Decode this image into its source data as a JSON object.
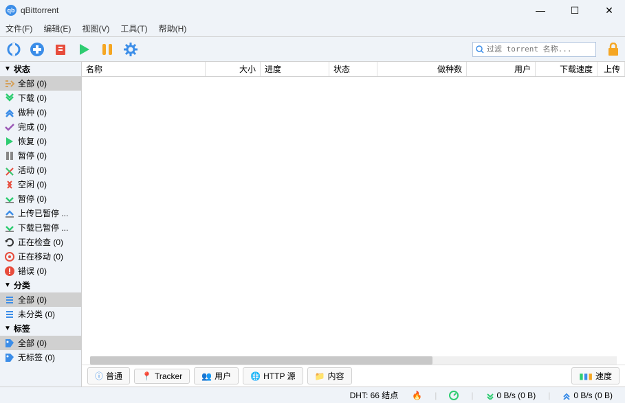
{
  "app": {
    "title": "qBittorrent"
  },
  "menu": {
    "file": "文件(F)",
    "edit": "编辑(E)",
    "view": "视图(V)",
    "tools": "工具(T)",
    "help": "帮助(H)"
  },
  "toolbar": {
    "search_placeholder": "过滤 torrent 名称..."
  },
  "sidebar": {
    "status_header": "状态",
    "status_items": [
      {
        "label": "全部 (0)",
        "color": "#d4a05a",
        "selected": true
      },
      {
        "label": "下载 (0)",
        "color": "#2ecc71"
      },
      {
        "label": "做种 (0)",
        "color": "#3b8de8"
      },
      {
        "label": "完成 (0)",
        "color": "#9b59b6"
      },
      {
        "label": "恢复 (0)",
        "color": "#2ecc71"
      },
      {
        "label": "暂停 (0)",
        "color": "#888888"
      },
      {
        "label": "活动 (0)",
        "color": "#e74c3c"
      },
      {
        "label": "空闲 (0)",
        "color": "#e74c3c"
      },
      {
        "label": "暂停 (0)",
        "color": "#2ecc71"
      },
      {
        "label": "上传已暂停 ...",
        "color": "#3b8de8"
      },
      {
        "label": "下载已暂停 ...",
        "color": "#2ecc71"
      },
      {
        "label": "正在检查 (0)",
        "color": "#333333"
      },
      {
        "label": "正在移动 (0)",
        "color": "#e74c3c"
      },
      {
        "label": "错误 (0)",
        "color": "#e74c3c"
      }
    ],
    "category_header": "分类",
    "category_items": [
      {
        "label": "全部 (0)",
        "color": "#3b8de8",
        "selected": true
      },
      {
        "label": "未分类 (0)",
        "color": "#3b8de8"
      }
    ],
    "tag_header": "标签",
    "tag_items": [
      {
        "label": "全部 (0)",
        "color": "#3b8de8",
        "selected": true
      },
      {
        "label": "无标签 (0)",
        "color": "#3b8de8"
      }
    ]
  },
  "columns": {
    "name": "名称",
    "size": "大小",
    "progress": "进度",
    "status": "状态",
    "seeds": "做种数",
    "peers": "用户",
    "dlspeed": "下载速度",
    "upspeed": "上传"
  },
  "bottom_tabs": {
    "general": "普通",
    "tracker": "Tracker",
    "peers": "用户",
    "http": "HTTP 源",
    "content": "内容",
    "speed": "速度"
  },
  "statusbar": {
    "dht": "DHT: 66 结点",
    "down": "0 B/s (0 B)",
    "up": "0 B/s (0 B)"
  }
}
